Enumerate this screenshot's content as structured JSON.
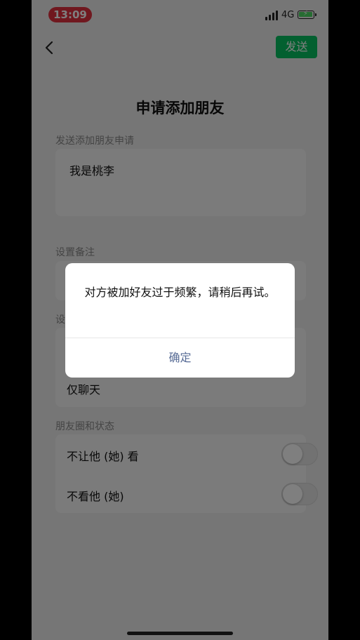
{
  "status_bar": {
    "time": "13:09",
    "network": "4G"
  },
  "nav": {
    "send_label": "发送"
  },
  "page": {
    "title": "申请添加朋友"
  },
  "request_section": {
    "label": "发送添加朋友申请",
    "text": "我是桃李"
  },
  "remark_section": {
    "label": "设置备注"
  },
  "permission_section": {
    "label_visible": "设",
    "option": "仅聊天"
  },
  "moments_section": {
    "label": "朋友圈和状态",
    "rows": [
      {
        "label": "不让他 (她) 看",
        "on": false
      },
      {
        "label": "不看他 (她)",
        "on": false
      }
    ]
  },
  "dialog": {
    "message": "对方被加好友过于频繁，请稍后再试。",
    "confirm_label": "确定"
  },
  "colors": {
    "accent": "#07c160",
    "link": "#576b95",
    "time_pill": "#e0303e"
  }
}
